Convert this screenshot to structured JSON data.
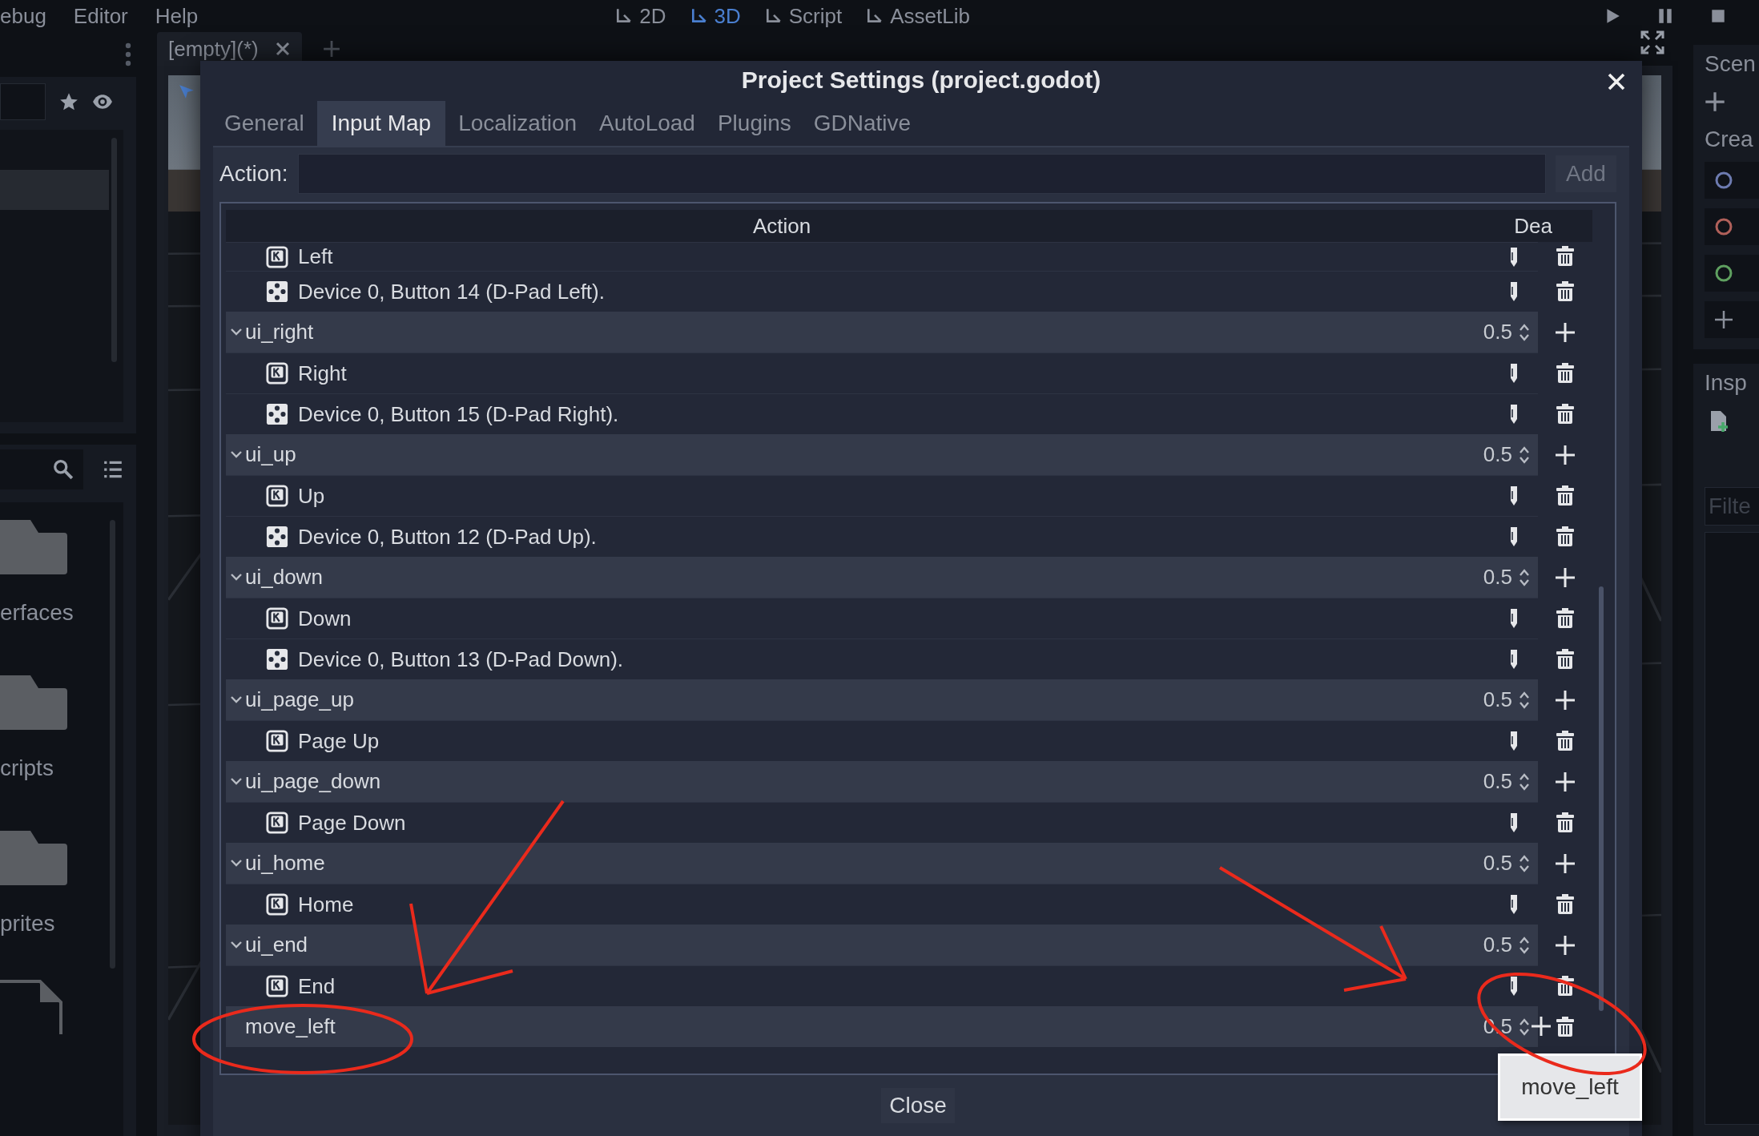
{
  "menu": [
    "ebug",
    "Editor",
    "Help"
  ],
  "workspaces": [
    {
      "label": "2D",
      "selected": false
    },
    {
      "label": "3D",
      "selected": true
    },
    {
      "label": "Script",
      "selected": false
    },
    {
      "label": "AssetLib",
      "selected": false
    }
  ],
  "scene_tab": {
    "title": "[empty](*)"
  },
  "left_dock": {
    "files": [
      {
        "kind": "folder",
        "name": "erfaces"
      },
      {
        "kind": "folder",
        "name": "cripts"
      },
      {
        "kind": "folder",
        "name": "prites"
      },
      {
        "kind": "file"
      }
    ]
  },
  "right_dock": {
    "scene_title": "Scen",
    "create_label": "Crea",
    "node_types": [
      {
        "color": "#6d7bb0"
      },
      {
        "color": "#b0605a"
      },
      {
        "color": "#5fa060"
      }
    ],
    "inspector_title": "Insp",
    "filter_placeholder": "Filte"
  },
  "dialog": {
    "title": "Project Settings (project.godot)",
    "tabs": [
      {
        "label": "General",
        "selected": false
      },
      {
        "label": "Input Map",
        "selected": true
      },
      {
        "label": "Localization",
        "selected": false
      },
      {
        "label": "AutoLoad",
        "selected": false
      },
      {
        "label": "Plugins",
        "selected": false
      },
      {
        "label": "GDNative",
        "selected": false
      }
    ],
    "action_label": "Action:",
    "add_button": "Add",
    "columns": [
      "Action",
      "Dea"
    ],
    "tree": [
      {
        "kind": "key",
        "label": "Left"
      },
      {
        "kind": "joypad",
        "label": "Device 0, Button 14 (D-Pad Left)."
      },
      {
        "kind": "action",
        "name": "ui_right",
        "deadzone": "0.5",
        "expanded": true,
        "removable": false,
        "children": [
          {
            "kind": "key",
            "label": "Right"
          },
          {
            "kind": "joypad",
            "label": "Device 0, Button 15 (D-Pad Right)."
          }
        ]
      },
      {
        "kind": "action",
        "name": "ui_up",
        "deadzone": "0.5",
        "expanded": true,
        "removable": false,
        "children": [
          {
            "kind": "key",
            "label": "Up"
          },
          {
            "kind": "joypad",
            "label": "Device 0, Button 12 (D-Pad Up)."
          }
        ]
      },
      {
        "kind": "action",
        "name": "ui_down",
        "deadzone": "0.5",
        "expanded": true,
        "removable": false,
        "children": [
          {
            "kind": "key",
            "label": "Down"
          },
          {
            "kind": "joypad",
            "label": "Device 0, Button 13 (D-Pad Down)."
          }
        ]
      },
      {
        "kind": "action",
        "name": "ui_page_up",
        "deadzone": "0.5",
        "expanded": true,
        "removable": false,
        "children": [
          {
            "kind": "key",
            "label": "Page Up"
          }
        ]
      },
      {
        "kind": "action",
        "name": "ui_page_down",
        "deadzone": "0.5",
        "expanded": true,
        "removable": false,
        "children": [
          {
            "kind": "key",
            "label": "Page Down"
          }
        ]
      },
      {
        "kind": "action",
        "name": "ui_home",
        "deadzone": "0.5",
        "expanded": true,
        "removable": false,
        "children": [
          {
            "kind": "key",
            "label": "Home"
          }
        ]
      },
      {
        "kind": "action",
        "name": "ui_end",
        "deadzone": "0.5",
        "expanded": true,
        "removable": false,
        "children": [
          {
            "kind": "key",
            "label": "End"
          }
        ]
      },
      {
        "kind": "action",
        "name": "move_left",
        "deadzone": "0.5",
        "removable": true
      }
    ],
    "close_button": "Close",
    "tooltip": "move_left"
  }
}
